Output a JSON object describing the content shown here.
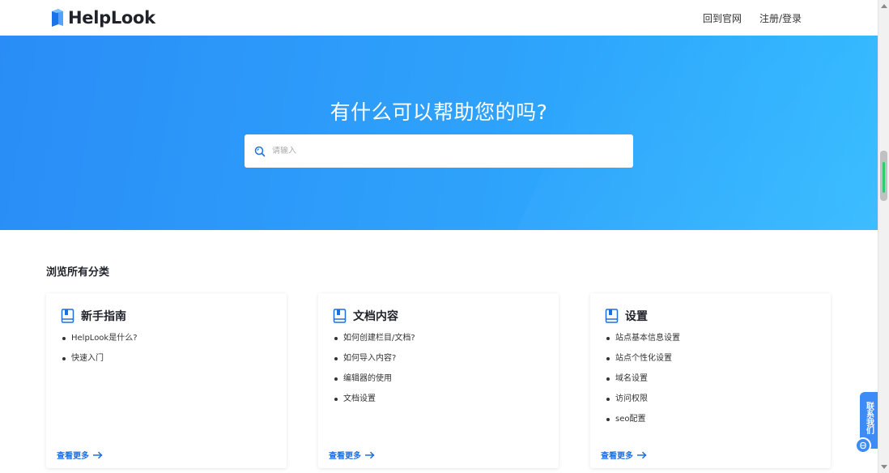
{
  "header": {
    "logo_text": "HelpLook",
    "nav": [
      {
        "label": "回到官网"
      },
      {
        "label": "注册/登录"
      }
    ]
  },
  "hero": {
    "title": "有什么可以帮助您的吗?",
    "search_placeholder": "请输入"
  },
  "main": {
    "section_title": "浏览所有分类",
    "categories": [
      {
        "title": "新手指南",
        "items": [
          "HelpLook是什么?",
          "快速入门"
        ],
        "more_label": "查看更多"
      },
      {
        "title": "文档内容",
        "items": [
          "如何创建栏目/文档?",
          "如何导入内容?",
          "编辑器的使用",
          "文档设置"
        ],
        "more_label": "查看更多"
      },
      {
        "title": "设置",
        "items": [
          "站点基本信息设置",
          "站点个性化设置",
          "域名设置",
          "访问权限",
          "seo配置"
        ],
        "more_label": "查看更多"
      }
    ]
  },
  "contact": {
    "label": "联系我们"
  },
  "colors": {
    "brand_blue": "#1f6fe0",
    "hero_start": "#2a8df7",
    "hero_end": "#2bb7ff"
  }
}
